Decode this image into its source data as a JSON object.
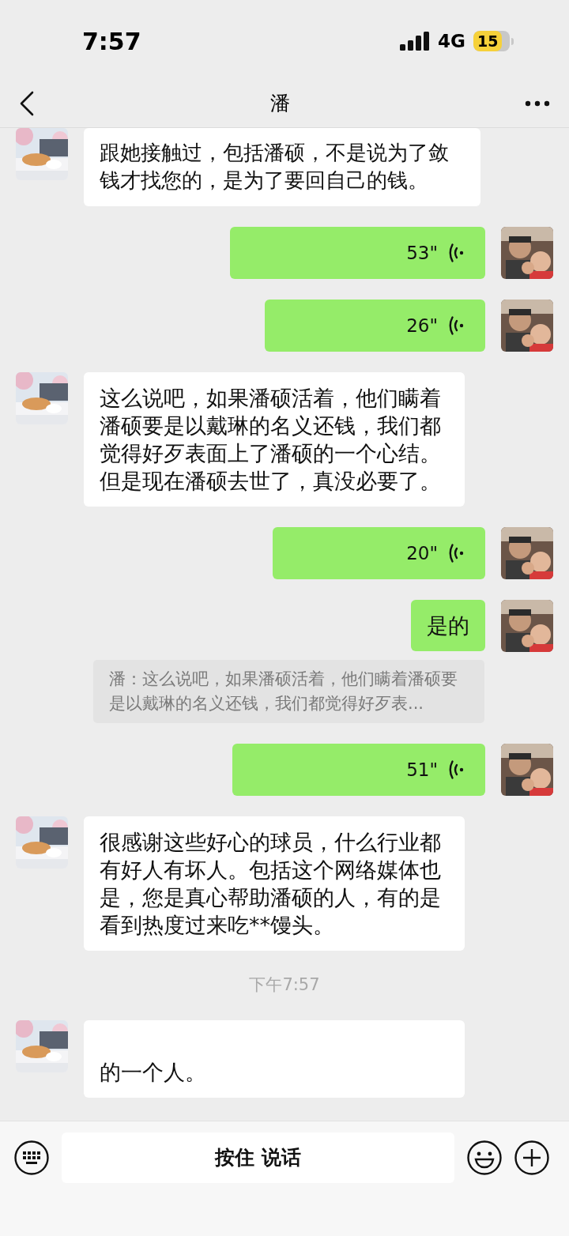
{
  "status_bar": {
    "time": "7:57",
    "network": "4G",
    "battery": "15"
  },
  "header": {
    "title": "潘"
  },
  "messages": [
    {
      "kind": "text",
      "outgoing": false,
      "text": "跟她接触过，包括潘硕，不是说为了敛钱才找您的，是为了要回自己的钱。"
    },
    {
      "kind": "voice",
      "outgoing": true,
      "duration": "53\""
    },
    {
      "kind": "voice",
      "outgoing": true,
      "duration": "26\""
    },
    {
      "kind": "text",
      "outgoing": false,
      "text": "这么说吧，如果潘硕活着，他们瞒着潘硕要是以戴琳的名义还钱，我们都觉得好歹表面上了潘硕的一个心结。但是现在潘硕去世了，真没必要了。"
    },
    {
      "kind": "voice",
      "outgoing": true,
      "duration": "20\""
    },
    {
      "kind": "text",
      "outgoing": true,
      "text": "是的"
    },
    {
      "kind": "quote",
      "text": "潘：这么说吧，如果潘硕活着，他们瞒着潘硕要是以戴琳的名义还钱，我们都觉得好歹表..."
    },
    {
      "kind": "voice",
      "outgoing": true,
      "duration": "51\""
    },
    {
      "kind": "text",
      "outgoing": false,
      "text": "很感谢这些好心的球员，什么行业都有好人有坏人。包括这个网络媒体也是，您是真心帮助潘硕的人，有的是看到热度过来吃**馒头。"
    },
    {
      "kind": "time",
      "text": "下午7:57"
    },
    {
      "kind": "obscured",
      "outgoing": false,
      "text": "的一个人。"
    }
  ],
  "input_bar": {
    "button": "按住 说话"
  }
}
